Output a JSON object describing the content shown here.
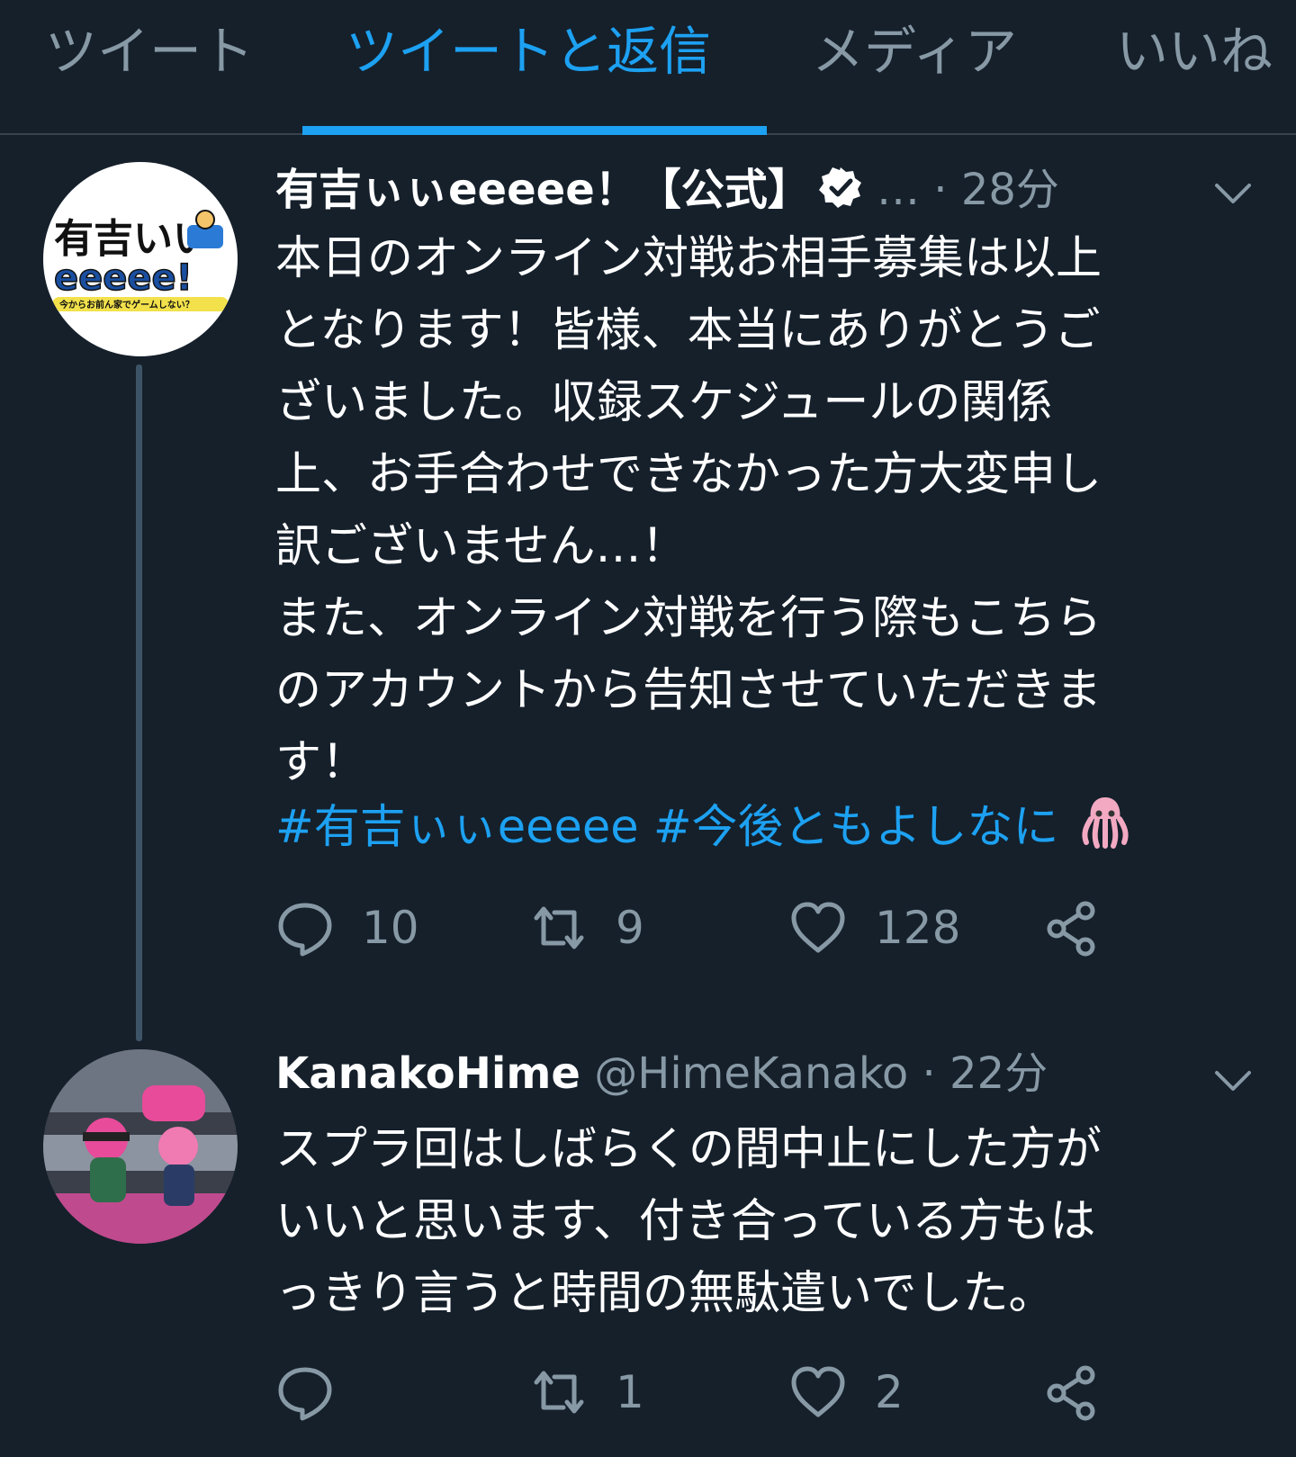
{
  "tabs": [
    {
      "label": "ツイート",
      "active": false
    },
    {
      "label": "ツイートと返信",
      "active": true
    },
    {
      "label": "メディア",
      "active": false
    },
    {
      "label": "いいね",
      "active": false
    }
  ],
  "colors": {
    "background": "#15202b",
    "accent": "#1da1f2",
    "muted": "#8899a6"
  },
  "tweets": [
    {
      "display_name": "有吉ぃぃeeeee！【公式】",
      "verified": true,
      "meta": "… · 28分",
      "avatar_text_1": "有吉いい",
      "avatar_text_2": "eeeee!",
      "avatar_text_3": "今からお前ん家でゲームしない？",
      "text": "本日のオンライン対戦お相手募集は以上\nとなります！皆様、本当にありがとうご\nざいました。収録スケジュールの関係\n上、お手合わせできなかった方大変申し\n訳ございません…！\nまた、オンライン対戦を行う際もこちら\nのアカウントから告知させていただきま\nす！",
      "hashtags": "#有吉ぃぃeeeee #今後ともよしなに",
      "emoji": "squid-emoji",
      "replies": "10",
      "retweets": "9",
      "likes": "128"
    },
    {
      "display_name": "KanakoHime",
      "meta": "@HimeKanako · 22分",
      "text": "スプラ回はしばらくの間中止にした方が\nいいと思います、付き合っている方もは\nっきり言うと時間の無駄遣いでした。",
      "replies": "",
      "retweets": "1",
      "likes": "2"
    }
  ]
}
